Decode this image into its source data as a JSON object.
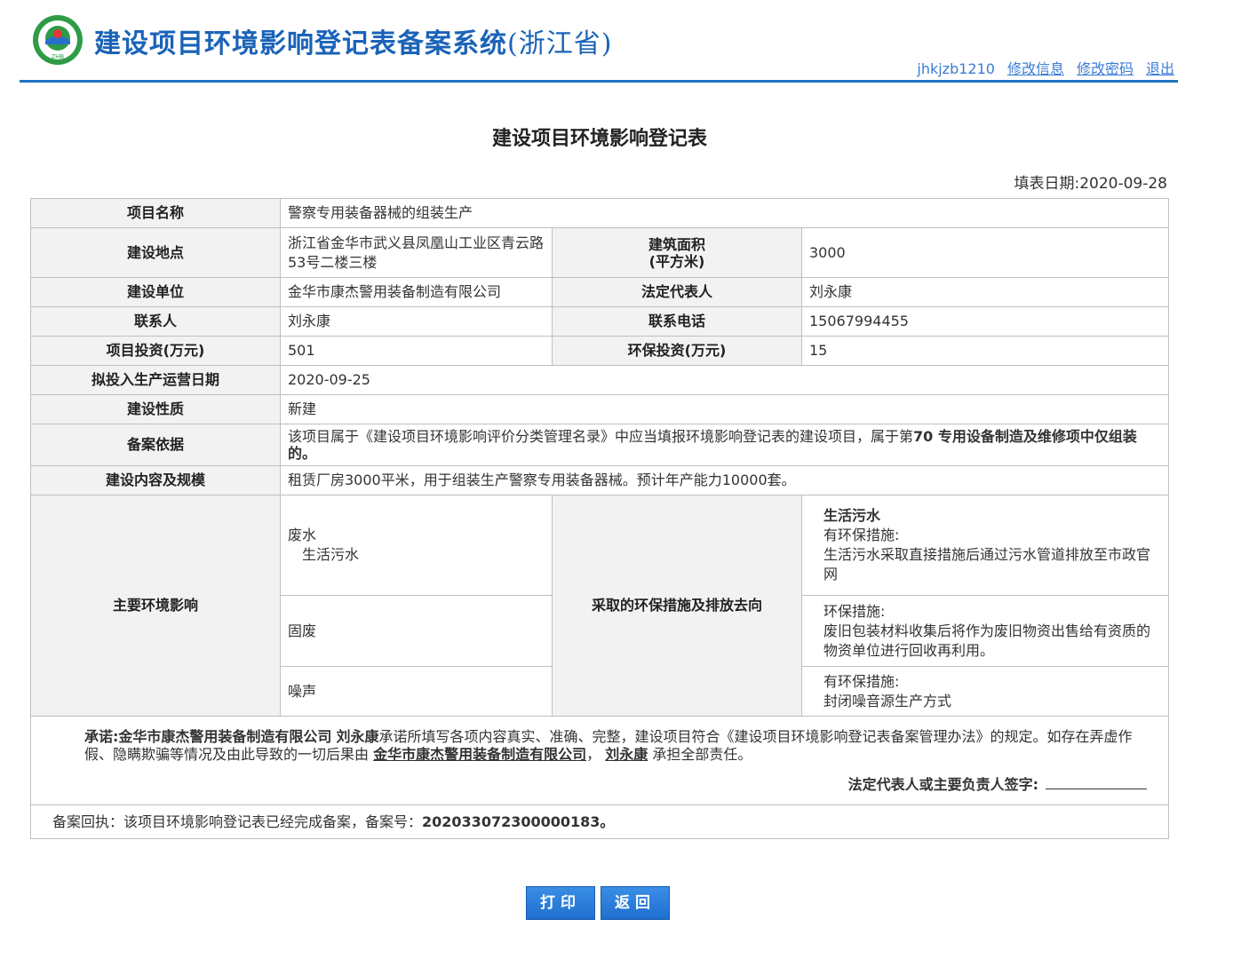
{
  "header": {
    "system_title": "建设项目环境影响登记表备案系统",
    "province": "(浙江省)",
    "logo_text": "ZHB",
    "username": "jhkjzb1210",
    "links": [
      "修改信息",
      "修改密码",
      "退出"
    ]
  },
  "form": {
    "title": "建设项目环境影响登记表",
    "fill_date_label": "填表日期:",
    "fill_date": "2020-09-28",
    "project_name_label": "项目名称",
    "project_name": "警察专用装备器械的组装生产",
    "location_label": "建设地点",
    "location": "浙江省金华市武义县凤凰山工业区青云路53号二楼三楼",
    "area_label": "建筑面积\n(平方米)",
    "area": "3000",
    "unit_label": "建设单位",
    "unit": "金华市康杰警用装备制造有限公司",
    "legal_rep_label": "法定代表人",
    "legal_rep": "刘永康",
    "contact_label": "联系人",
    "contact": "刘永康",
    "phone_label": "联系电话",
    "phone": "15067994455",
    "investment_label": "项目投资(万元)",
    "investment": "501",
    "env_investment_label": "环保投资(万元)",
    "env_investment": "15",
    "start_date_label": "拟投入生产运营日期",
    "start_date": "2020-09-25",
    "nature_label": "建设性质",
    "nature": "新建",
    "basis_label": "备案依据",
    "basis_prefix": "该项目属于《建设项目环境影响评价分类管理名录》中应当填报环境影响登记表的建设项目，属于第",
    "basis_bold": "70 专用设备制造及维修项中仅组装的。",
    "scale_label": "建设内容及规模",
    "scale": "租赁厂房3000平米，用于组装生产警察专用装备器械。预计年产能力10000套。",
    "impact_label": "主要环境影响",
    "measures_label": "采取的环保措施及排放去向",
    "wastewater": "废水",
    "wastewater_sub": "生活污水",
    "wastewater_measure_title": "生活污水",
    "wastewater_measure_head": "有环保措施:",
    "wastewater_measure": "生活污水采取直接措施后通过污水管道排放至市政官网",
    "solid": "固废",
    "solid_measure_head": "环保措施:",
    "solid_measure": "废旧包装材料收集后将作为废旧物资出售给有资质的物资单位进行回收再利用。",
    "noise": "噪声",
    "noise_measure_head": "有环保措施:",
    "noise_measure": "封闭噪音源生产方式",
    "promise_label": "承诺:",
    "promise_company": "金华市康杰警用装备制造有限公司",
    "promise_person": "刘永康",
    "promise_text": "承诺所填写各项内容真实、准确、完整，建设项目符合《建设项目环境影响登记表备案管理办法》的规定。如存在弄虚作假、隐瞒欺骗等情况及由此导致的一切后果由",
    "promise_company2": "金华市康杰警用装备制造有限公司",
    "promise_sep": "，",
    "promise_person2": "刘永康",
    "promise_tail": "承担全部责任。",
    "signature_label": "法定代表人或主要负责人签字:",
    "receipt_label": "备案回执：该项目环境影响登记表已经完成备案，备案号：",
    "receipt_no": "202033072300000183。"
  },
  "buttons": {
    "print": "打印",
    "back": "返回"
  },
  "colors": {
    "brand_blue": "#1a63b8",
    "button_blue": "#1f6fd0"
  }
}
